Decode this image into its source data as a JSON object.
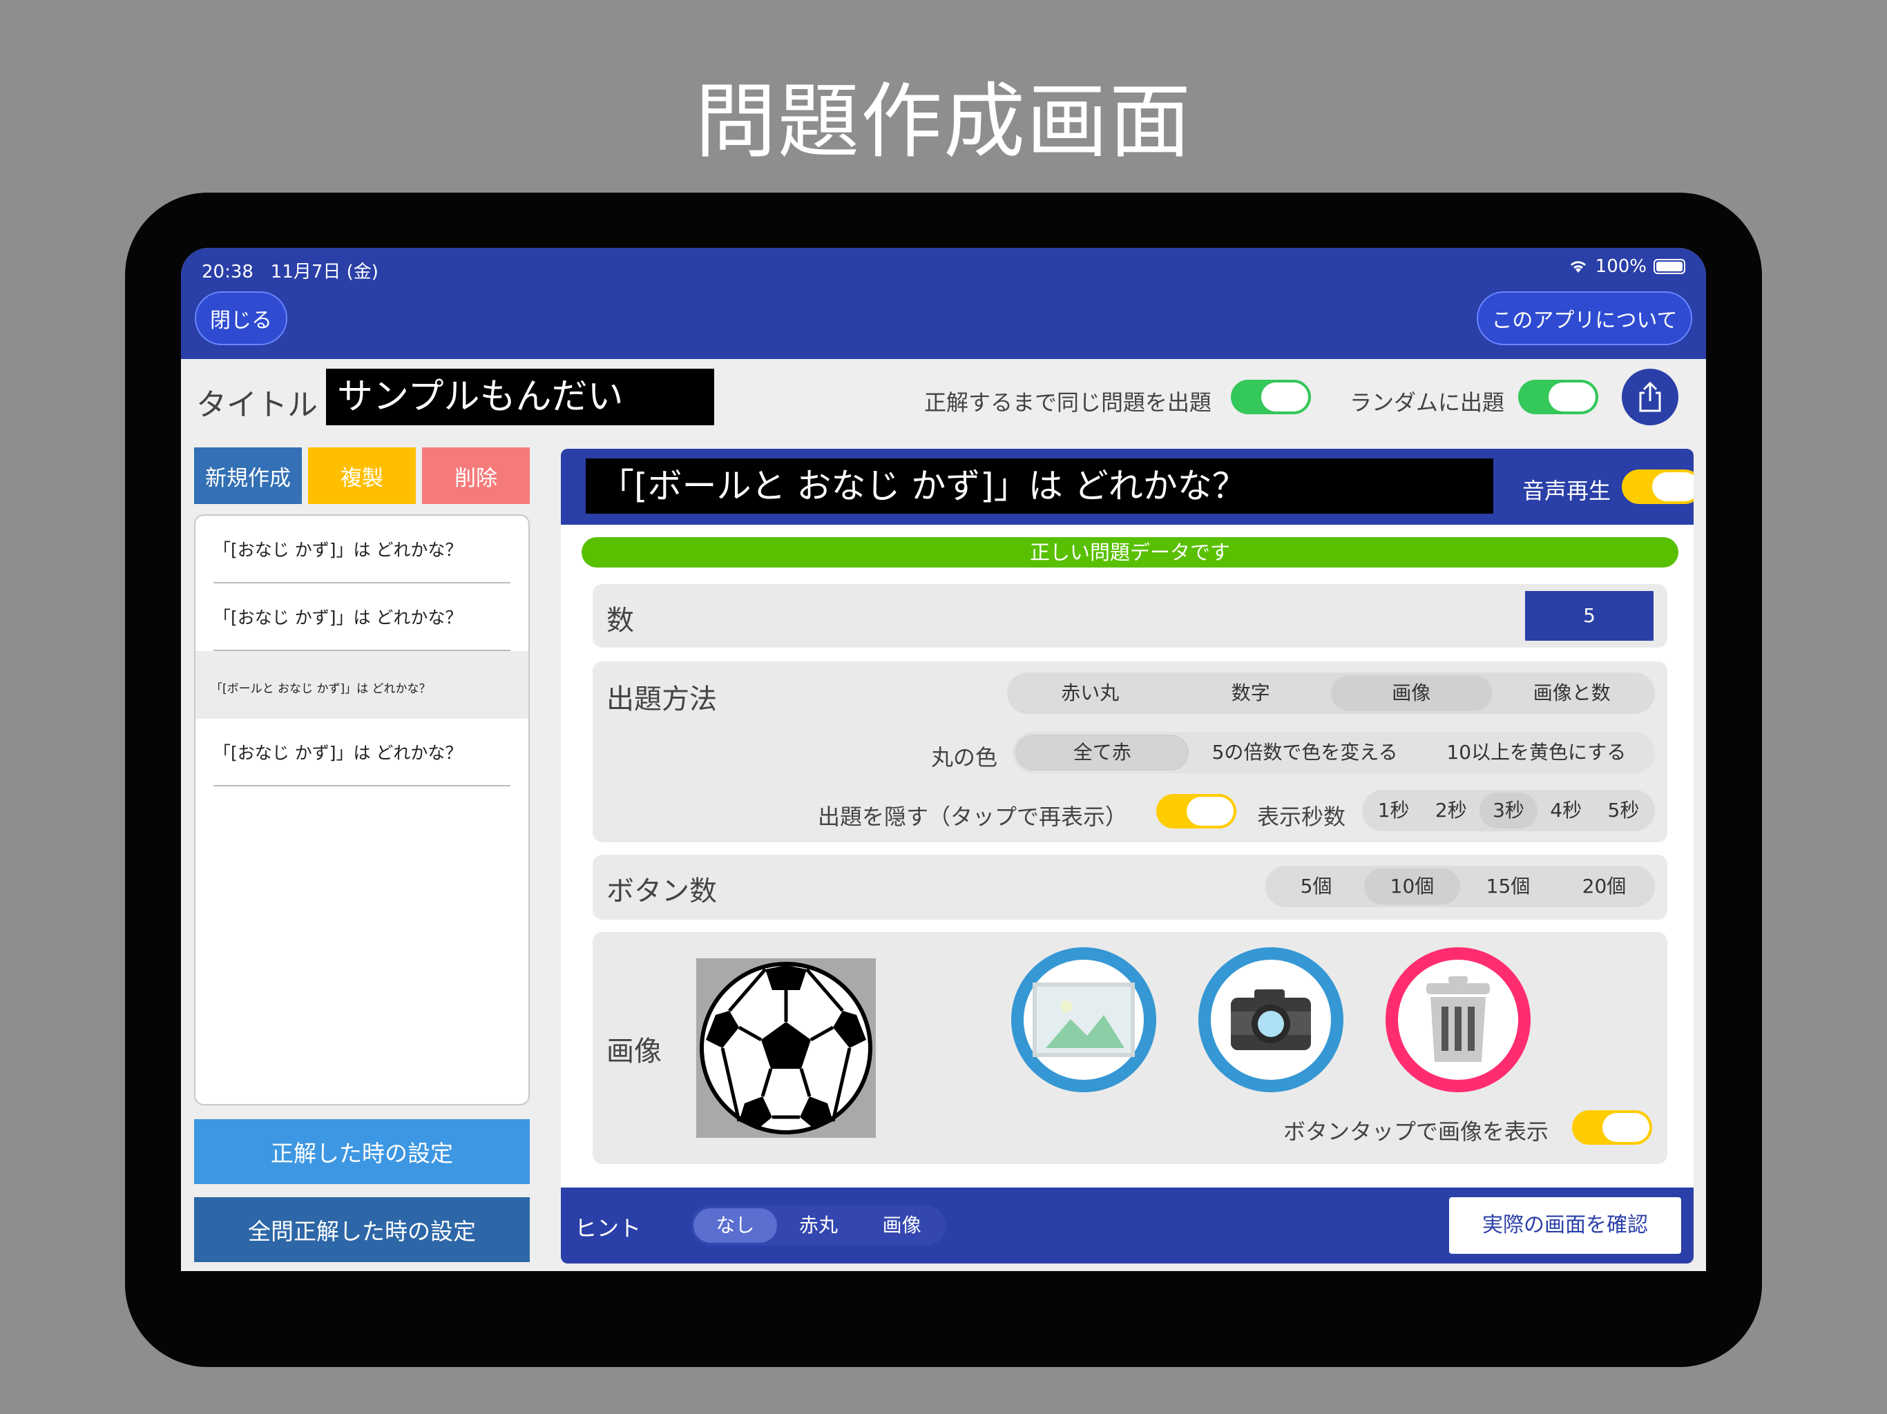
{
  "headline": "問題作成画面",
  "status": {
    "time": "20:38",
    "date": "11月7日 (金)",
    "battery": "100%"
  },
  "nav": {
    "close_label": "閉じる",
    "about_label": "このアプリについて"
  },
  "title_bar": {
    "label": "タイトル",
    "value": "サンプルもんだい",
    "repeat_label": "正解するまで同じ問題を出題",
    "random_label": "ランダムに出題"
  },
  "left_pane": {
    "new_label": "新規作成",
    "copy_label": "複製",
    "delete_label": "削除",
    "questions": [
      "「[おなじ かず]」は どれかな？",
      "「[おなじ かず]」は どれかな？",
      "「[ボールと おなじ かず]」は どれかな？",
      "「[おなじ かず]」は どれかな？"
    ],
    "correct_settings_label": "正解した時の設定",
    "all_correct_settings_label": "全問正解した時の設定"
  },
  "editor": {
    "question": "「[ボールと おなじ かず]」は どれかな？",
    "voice_label": "音声再生",
    "valid_message": "正しい問題データです",
    "count": {
      "label": "数",
      "value": "5"
    },
    "mode": {
      "label": "出題方法",
      "options": [
        "赤い丸",
        "数字",
        "画像",
        "画像と数"
      ],
      "selected": "画像"
    },
    "circle_color": {
      "label": "丸の色",
      "options": [
        "全て赤",
        "5の倍数で色を変える",
        "10以上を黄色にする"
      ],
      "selected": "全て赤"
    },
    "hide": {
      "label": "出題を隠す（タップで再表示）"
    },
    "seconds": {
      "label": "表示秒数",
      "options": [
        "1秒",
        "2秒",
        "3秒",
        "4秒",
        "5秒"
      ],
      "selected": "3秒"
    },
    "buttons": {
      "label": "ボタン数",
      "options": [
        "5個",
        "10個",
        "15個",
        "20個"
      ],
      "selected": "10個"
    },
    "image": {
      "label": "画像",
      "show_on_tap_label": "ボタンタップで画像を表示"
    },
    "hint": {
      "label": "ヒント",
      "options": [
        "なし",
        "赤丸",
        "画像"
      ],
      "selected": "なし"
    },
    "preview_label": "実際の画面を確認"
  },
  "colors": {
    "brand_blue": "#2a3fa7",
    "toggle_green": "#34c759",
    "toggle_yellow": "#ffcc00",
    "valid_green": "#58c000",
    "gallery_ring": "#3597d3",
    "trash_ring": "#ff2d6f"
  }
}
